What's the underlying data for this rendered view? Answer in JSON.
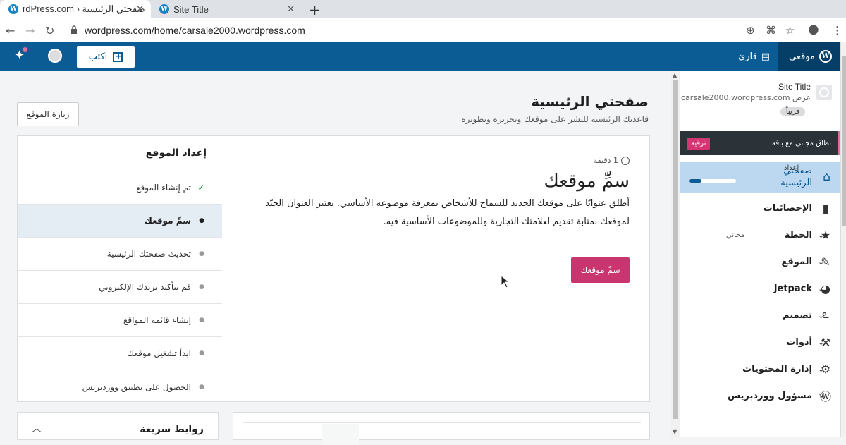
{
  "browser": {
    "tabs": [
      {
        "title": "صفحتي الرئيسية ‹ rdPress.com",
        "icon": "wordpress-icon"
      },
      {
        "title": "Site Title",
        "icon": "wordpress-icon"
      }
    ],
    "url": "wordpress.com/home/carsale2000.wordpress.com"
  },
  "masterbar": {
    "my_sites": "موقعي",
    "reader": "قارئ",
    "write": "اكتب"
  },
  "sidebar": {
    "site_title": "Site Title",
    "site_url": "عرض carsale2000.wordpress.com",
    "soon_badge": "قريباً",
    "upgrade_text": "نطاق مجاني مع باقة",
    "upgrade_button": "ترقية",
    "home_label": "صفحتي الرئيسية",
    "setup_label": "إعداد",
    "setup_progress": 0.25,
    "items": [
      {
        "label": "الإحصائيات",
        "icon": "stats-icon"
      },
      {
        "label": "الخطة",
        "icon": "star-icon",
        "badge": "مجاني"
      },
      {
        "label": "الموقع",
        "icon": "pencil-icon"
      },
      {
        "label": "Jetpack",
        "icon": "jetpack-icon"
      },
      {
        "label": "تصميم",
        "icon": "design-icon"
      },
      {
        "label": "أدوات",
        "icon": "wrench-icon"
      },
      {
        "label": "إدارة المحتويات",
        "icon": "gear-icon"
      },
      {
        "label": "مسؤول ووردبريس",
        "icon": "wordpress-icon"
      }
    ]
  },
  "main": {
    "title": "صفحتي الرئيسية",
    "subtitle": "قاعدتك الرئيسية للنشر على موقعك وتحريره وتطويره",
    "visit_site": "زيارة الموقع",
    "checklist_title": "إعداد الموقع",
    "tasks": [
      {
        "label": "تم إنشاء الموقع",
        "state": "done"
      },
      {
        "label": "سمِّ موقعك",
        "state": "current"
      },
      {
        "label": "تحديث صفحتك الرئيسية",
        "state": "todo"
      },
      {
        "label": "قم بتأكيد بريدك الإلكتروني",
        "state": "todo"
      },
      {
        "label": "إنشاء قائمة المواقع",
        "state": "todo"
      },
      {
        "label": "ابدأ تشغيل موقعك",
        "state": "todo"
      },
      {
        "label": "الحصول على تطبيق ووردبريس",
        "state": "todo"
      }
    ],
    "detail": {
      "duration": "1 دقيقة",
      "heading": "سمِّ موقعك",
      "body": "أطلق عنوانًا على موقعك الجديد للسماح للأشخاص بمعرفة موضوعه الأساسي. يعتبر العنوان الجيّد لموقعك بمثابة تقديم لعلامتك التجارية وللموضوعات الأساسية فيه.",
      "cta": "سمِّ موقعك"
    },
    "quick_links": "روابط سريعة"
  }
}
